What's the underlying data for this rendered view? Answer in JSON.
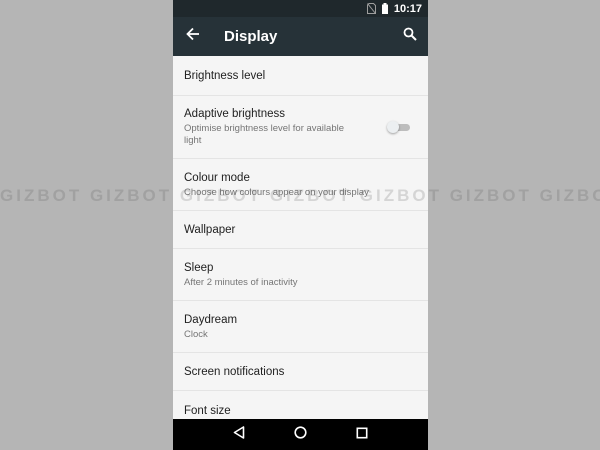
{
  "status_bar": {
    "time": "10:17",
    "icons": [
      "no-sim-icon",
      "battery-icon"
    ]
  },
  "toolbar": {
    "title": "Display",
    "back_icon": "arrow-left-icon",
    "search_icon": "search-icon"
  },
  "settings": [
    {
      "label": "Brightness level",
      "summary": ""
    },
    {
      "label": "Adaptive brightness",
      "summary": "Optimise brightness level for available light",
      "toggle": {
        "state": "off"
      }
    },
    {
      "label": "Colour mode",
      "summary": "Choose how colours appear on your display"
    },
    {
      "label": "Wallpaper",
      "summary": ""
    },
    {
      "label": "Sleep",
      "summary": "After 2 minutes of inactivity"
    },
    {
      "label": "Daydream",
      "summary": "Clock"
    },
    {
      "label": "Screen notifications",
      "summary": ""
    },
    {
      "label": "Font size",
      "summary": ""
    }
  ],
  "watermark": "GIZBOT GIZBOT GIZBOT GIZBOT GIZBOT GIZBOT GIZBOT",
  "nav_bar": {
    "icons": [
      "back-triangle-icon",
      "home-circle-icon",
      "recents-square-icon"
    ]
  },
  "colors": {
    "toolbar": "#263238",
    "status_bar": "#1f282c",
    "list_background": "#f5f5f5",
    "page_background": "#b5b5b5"
  }
}
